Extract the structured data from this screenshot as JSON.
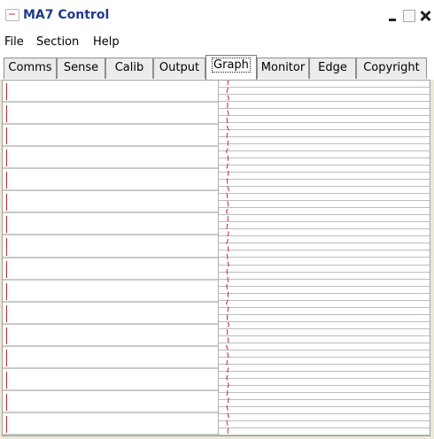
{
  "window": {
    "title": "MA7 Control",
    "app_icon": "app-icon"
  },
  "menu": {
    "items": [
      "File",
      "Section",
      "Help"
    ]
  },
  "tabs": {
    "items": [
      "Comms",
      "Sense",
      "Calib",
      "Output",
      "Graph",
      "Monitor",
      "Edge",
      "Copyright"
    ],
    "active": "Graph"
  },
  "graph": {
    "left_rows": 16,
    "right_rows": 50,
    "colors": {
      "trace": "#c0282e",
      "row_line": "#c9c9c9",
      "fine_line": "#bdbdbd"
    }
  }
}
